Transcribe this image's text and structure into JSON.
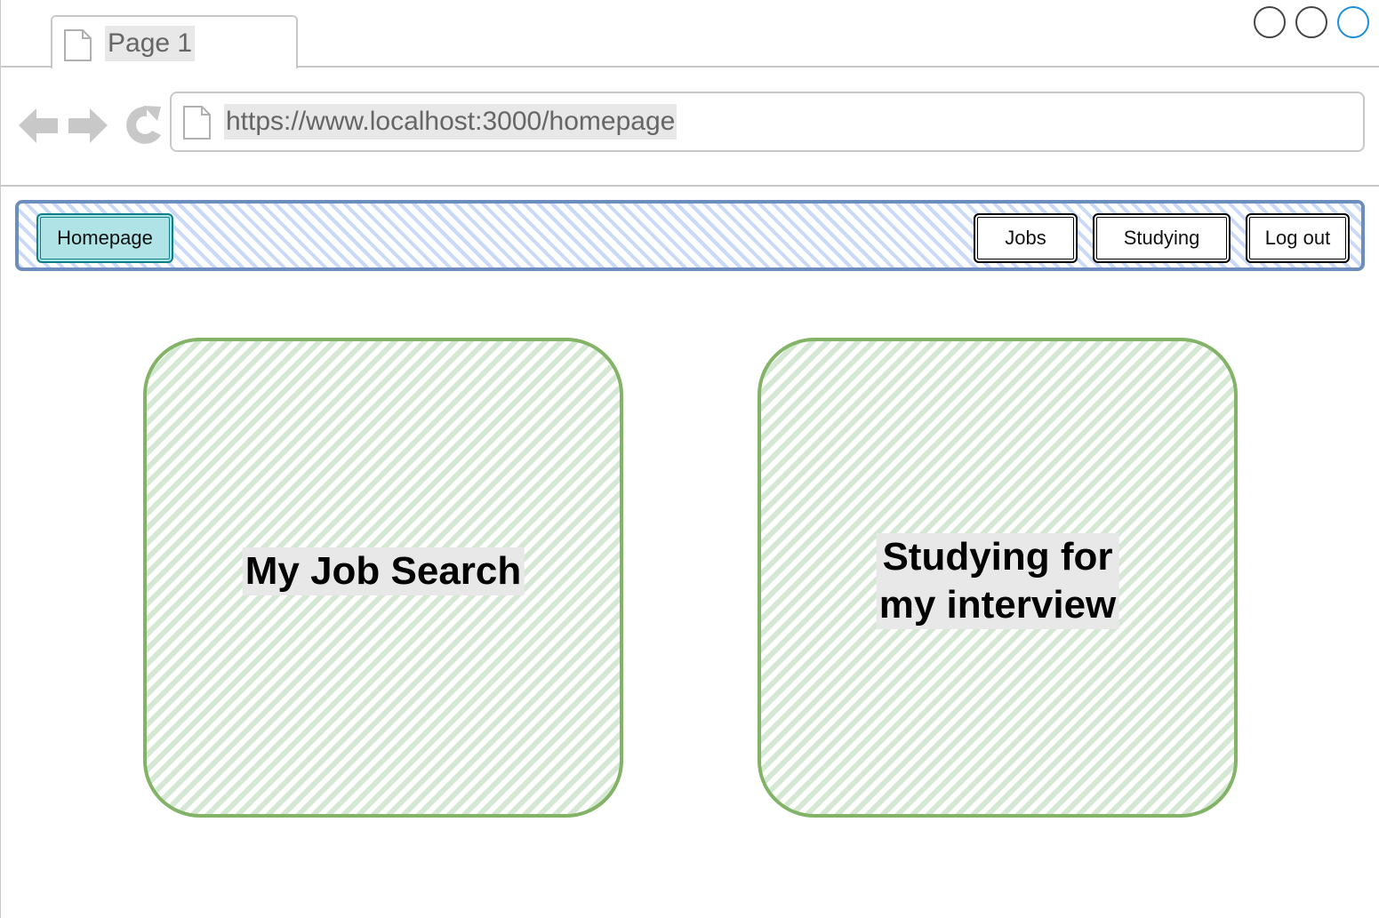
{
  "browser": {
    "tab": {
      "title": "Page 1"
    },
    "window_controls": [
      "minimize",
      "maximize",
      "close"
    ],
    "address_bar": {
      "url": "https://www.localhost:3000/homepage"
    },
    "nav_icons": [
      "back-icon",
      "forward-icon",
      "reload-icon"
    ]
  },
  "navbar": {
    "home_label": "Homepage",
    "items": [
      {
        "label": "Jobs"
      },
      {
        "label": "Studying"
      },
      {
        "label": "Log out"
      }
    ]
  },
  "cards": [
    {
      "label": "My Job Search"
    },
    {
      "label_line1": "Studying for",
      "label_line2": "my interview"
    }
  ],
  "colors": {
    "navbar_border": "#6c8ebf",
    "navbar_hatch": "#c9d9f7",
    "home_button_fill": "#b0e3e6",
    "home_button_border": "#0e8088",
    "card_border": "#82b366",
    "card_hatch": "#d5e8d4",
    "close_button": "#1a8fe0"
  }
}
